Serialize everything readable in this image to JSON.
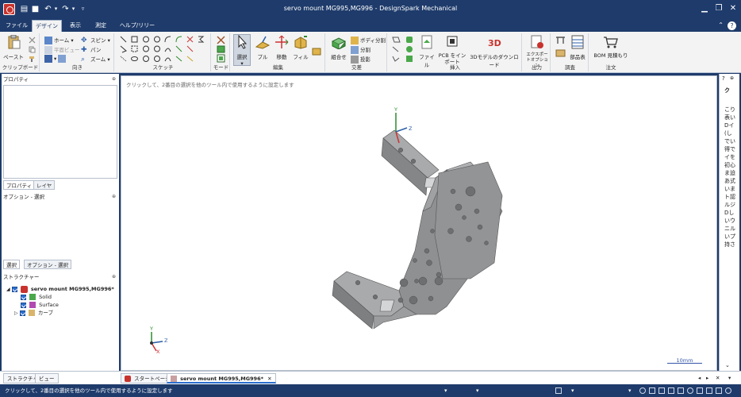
{
  "window": {
    "title": "servo mount MG995,MG996 - DesignSpark Mechanical"
  },
  "menu": {
    "tabs": [
      "ファイル",
      "デザイン",
      "表示",
      "測定",
      "ヘルプ/リリース"
    ],
    "active_tab": "デザイン"
  },
  "ribbon": {
    "clipboard": {
      "label": "クリップボード",
      "paste": "ペースト"
    },
    "orient": {
      "label": "向き",
      "home": "ホーム",
      "plan_view": "平面ビュー",
      "spin": "スピン",
      "pan": "パン",
      "zoom": "ズーム"
    },
    "sketch": {
      "label": "スケッチ"
    },
    "mode": {
      "label": "モード"
    },
    "edit": {
      "label": "編集",
      "select": "選択",
      "pull": "プル",
      "move": "移動",
      "fill": "フィル"
    },
    "intersect": {
      "label": "交差",
      "combine": "組合せ",
      "split_body": "ボディ分割",
      "split": "分割",
      "project": "投影"
    },
    "insert": {
      "label": "挿入",
      "file": "ファイル",
      "pcb_import": "PCB をインポート",
      "model_download": "3Dモデルのダウンロード"
    },
    "output": {
      "label": "出力",
      "export_options": "エクスポートオプション"
    },
    "investigate": {
      "label": "調査",
      "parts_table": "部品表"
    },
    "order": {
      "label": "注文",
      "bom_quote": "BOM 見積もり"
    }
  },
  "left_panel": {
    "properties_header": "プロパティ",
    "tabs_top": [
      "プロパティ",
      "レイヤ"
    ],
    "options_header": "オプション - 選択",
    "tabs_mid": [
      "選択",
      "オプション - 選択"
    ],
    "structure_header": "ストラクチャー",
    "tree": {
      "root": "servo mount MG995,MG996*",
      "items": [
        "Solid",
        "Surface",
        "カーブ"
      ]
    },
    "bottom_tabs": [
      "ストラクチャー",
      "ビュー"
    ]
  },
  "viewport": {
    "hint": "クリックして、2番目の選択を他のツール内で使用するように設定します",
    "scale_label": "10mm",
    "axis_labels": {
      "x": "X",
      "y": "Y",
      "z": "Z"
    }
  },
  "right_panel": {
    "text": "こり表いDイ(しでい得でイを初心ま迫あ式いまト認ルジDしいウニルいプ持さ"
  },
  "doc_tabs": {
    "start_page": "スタートページ",
    "active_doc": "servo mount MG995,MG996*"
  },
  "status": {
    "text": "クリックして、2番目の選択を他のツール内で使用するように設定します"
  },
  "colors": {
    "chrome": "#1e3b6b",
    "model_fill": "#8f9092",
    "accent": "#2b6ecf"
  }
}
